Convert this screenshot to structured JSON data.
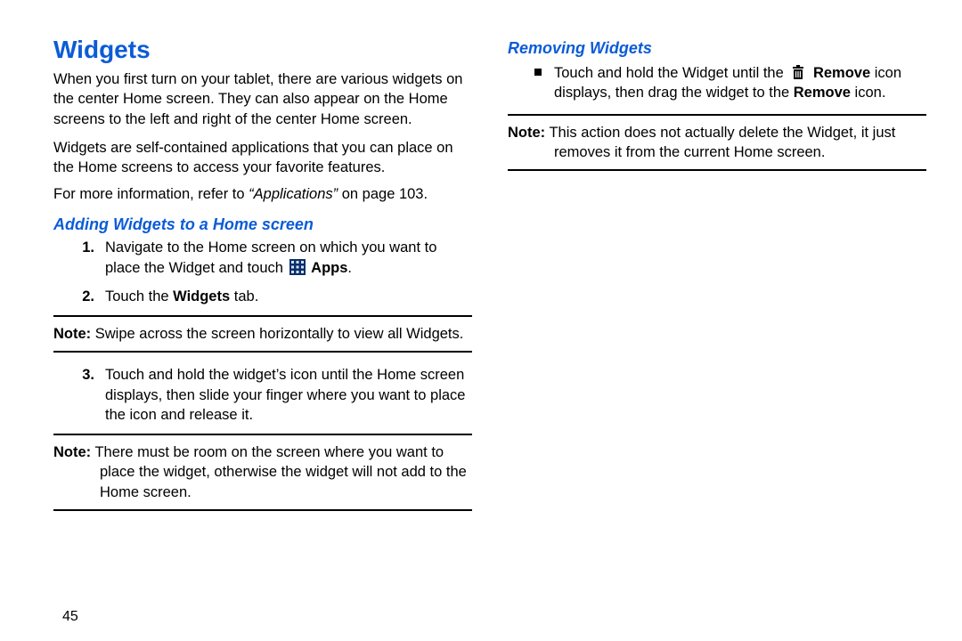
{
  "pageNumber": "45",
  "left": {
    "title": "Widgets",
    "intro1": "When you first turn on your tablet, there are various widgets on the center Home screen. They can also appear on the Home screens to the left and right of the center Home screen.",
    "intro2": "Widgets are self-contained applications that you can place on the Home screens to access your favorite features.",
    "ref_prefix": "For more information, refer to ",
    "ref_quote": "“Applications”",
    "ref_suffix": " on page 103.",
    "sub1": "Adding Widgets to a Home screen",
    "steps": [
      {
        "n": "1.",
        "a": "Navigate to the Home screen on which you want to place the Widget and touch ",
        "b": "Apps",
        "c": "."
      },
      {
        "n": "2.",
        "a": "Touch the ",
        "b": "Widgets",
        "c": " tab."
      }
    ],
    "note1_label": "Note:",
    "note1_text": " Swipe across the screen horizontally to view all Widgets.",
    "step3": {
      "n": "3.",
      "text": "Touch and hold the widget’s icon until the Home screen displays, then slide your finger where you want to place the icon and release it."
    },
    "note2_label": "Note:",
    "note2_text": " There must be room on the screen where you want to place the widget, otherwise the widget will not add to the Home screen."
  },
  "right": {
    "sub": "Removing Widgets",
    "bullet_a": "Touch and hold the Widget until the ",
    "bullet_b1": "Remove",
    "bullet_mid": " icon displays, then drag the widget to the ",
    "bullet_b2": "Remove",
    "bullet_end": " icon.",
    "note_label": "Note:",
    "note_text": " This action does not actually delete the Widget, it just removes it from the current Home screen."
  }
}
